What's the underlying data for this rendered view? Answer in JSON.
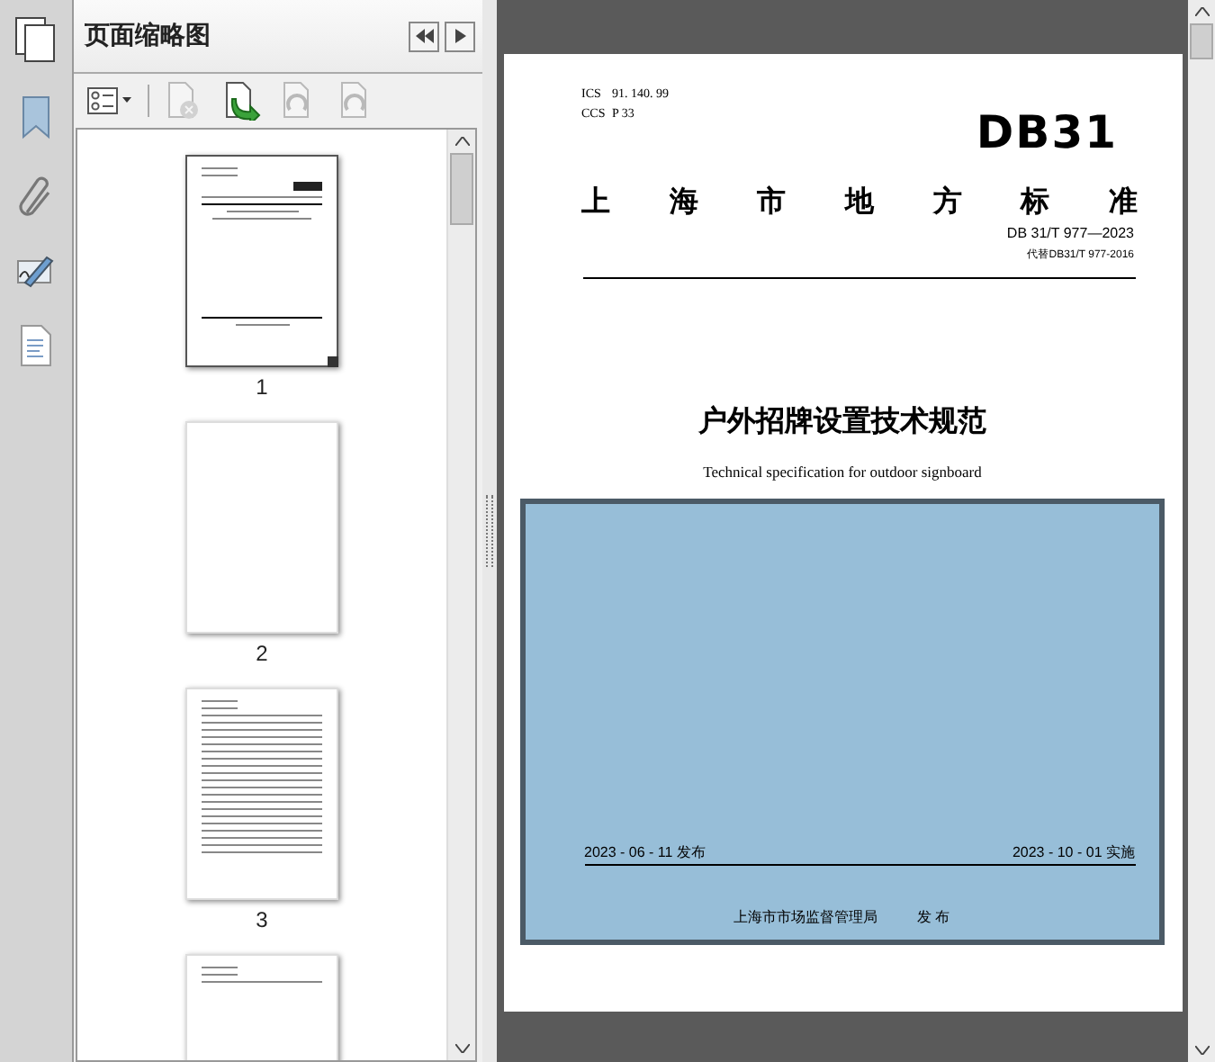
{
  "panel": {
    "title": "页面缩略图"
  },
  "tools": [
    {
      "kind": "options",
      "disabled": false
    },
    {
      "kind": "delete",
      "disabled": true
    },
    {
      "kind": "insert",
      "disabled": false
    },
    {
      "kind": "rotate-left",
      "disabled": true
    },
    {
      "kind": "rotate-right",
      "disabled": true
    }
  ],
  "thumbnails": [
    {
      "label": "1",
      "kind": "cover",
      "selected": true
    },
    {
      "label": "2",
      "kind": "blank",
      "selected": false
    },
    {
      "label": "3",
      "kind": "toc",
      "selected": false
    },
    {
      "kind": "list",
      "selected": false
    }
  ],
  "document": {
    "codes": [
      {
        "label": "ICS",
        "value": "91. 140. 99"
      },
      {
        "label": "CCS",
        "value": "P 33"
      }
    ],
    "logo": "DB31",
    "org": "上海市地方标准",
    "number": "DB 31/T  977—2023",
    "replaces": "代替DB31/T 977-2016",
    "title": "户外招牌设置技术规范",
    "subtitle": "Technical specification for outdoor signboard",
    "publish_date": "2023 - 06 - 11 发布",
    "effective_date": "2023 - 10 - 01 实施",
    "issuer": "上海市市场监督管理局",
    "issuer_action": "发 布"
  }
}
